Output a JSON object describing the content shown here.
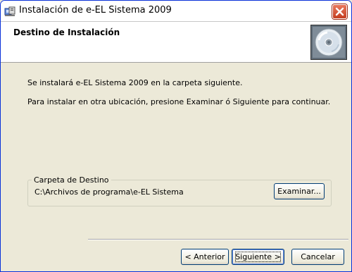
{
  "window": {
    "title": "Instalación de e-EL Sistema 2009",
    "icons": {
      "app": "installer-icon",
      "close": "close-icon",
      "header": "cd-disc-icon"
    }
  },
  "header": {
    "title": "Destino de Instalación"
  },
  "body": {
    "line1": "Se instalará e-EL Sistema 2009 en la carpeta siguiente.",
    "line2": "Para instalar en otra ubicación, presione Examinar ó Siguiente para continuar."
  },
  "destination": {
    "group_label": "Carpeta de Destino",
    "path": "C:\\Archivos de programa\\e-EL Sistema",
    "browse_label": "Examinar..."
  },
  "footer": {
    "back_label": "< Anterior",
    "next_label": "Siguiente >",
    "cancel_label": "Cancelar"
  },
  "colors": {
    "dialog_bg": "#ece9d8",
    "header_bg": "#ffffff",
    "button_border": "#003c74",
    "close_red": "#c33d20"
  }
}
